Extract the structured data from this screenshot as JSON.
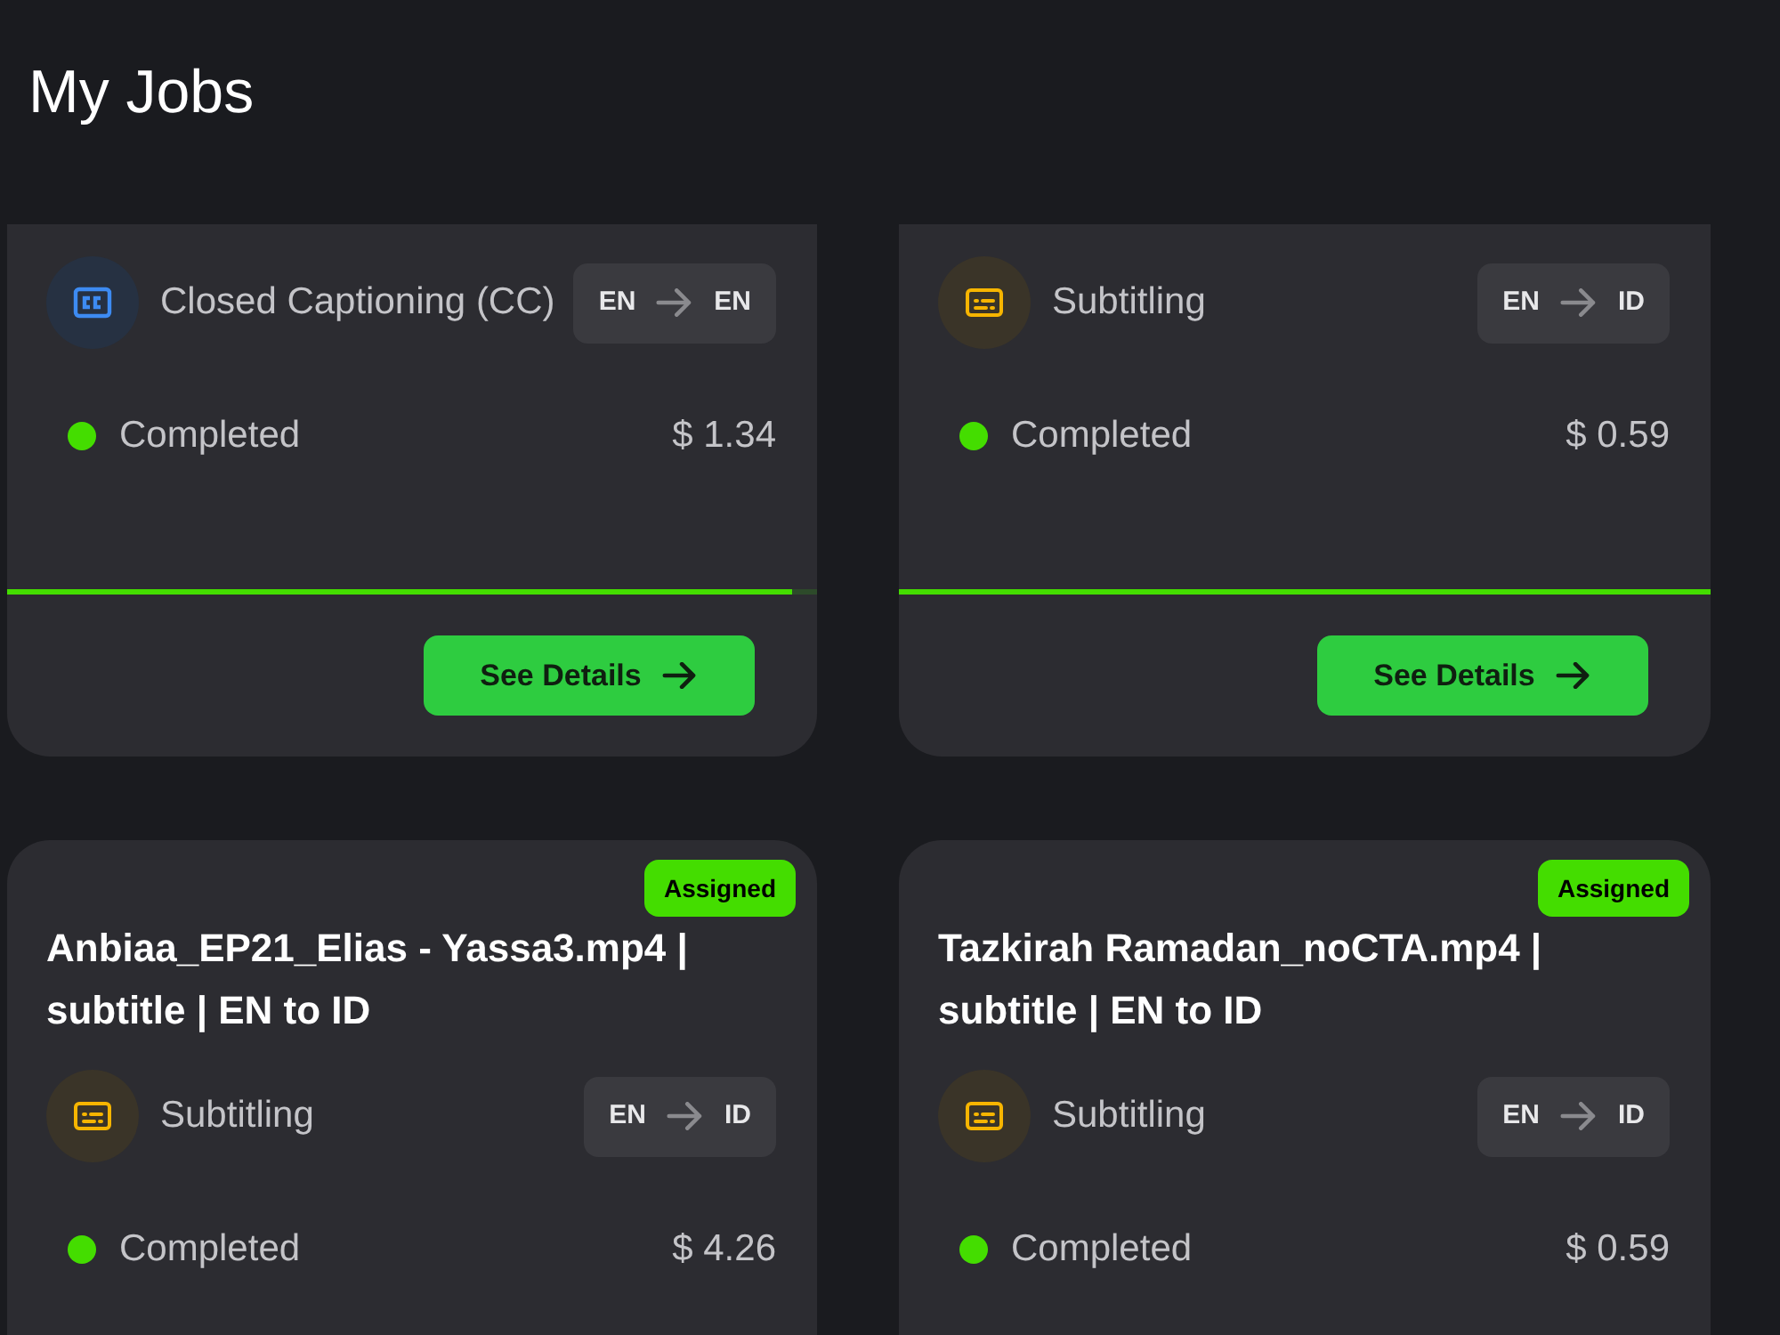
{
  "page": {
    "title": "My Jobs"
  },
  "jobs": [
    {
      "service": {
        "kind": "cc",
        "name": "Closed Captioning (CC)"
      },
      "languages": {
        "source": "EN",
        "target": "EN"
      },
      "status": {
        "label": "Completed",
        "color": "#44dd00"
      },
      "price": "$ 1.34",
      "progress": {
        "level": 0.97
      },
      "button": "See Details"
    },
    {
      "service": {
        "kind": "subtitle",
        "name": "Subtitling"
      },
      "languages": {
        "source": "EN",
        "target": "ID"
      },
      "status": {
        "label": "Completed",
        "color": "#44dd00"
      },
      "price": "$ 0.59",
      "progress": {
        "level": 1
      },
      "button": "See Details"
    },
    {
      "badge": "Assigned",
      "title": "Anbiaa_EP21_Elias - Yassa3.mp4 | subtitle | EN to ID",
      "service": {
        "kind": "subtitle",
        "name": "Subtitling"
      },
      "languages": {
        "source": "EN",
        "target": "ID"
      },
      "status": {
        "label": "Completed",
        "color": "#44dd00"
      },
      "price": "$ 4.26"
    },
    {
      "badge": "Assigned",
      "title": "Tazkirah Ramadan_noCTA.mp4 | subtitle | EN to ID",
      "service": {
        "kind": "subtitle",
        "name": "Subtitling"
      },
      "languages": {
        "source": "EN",
        "target": "ID"
      },
      "status": {
        "label": "Completed",
        "color": "#44dd00"
      },
      "price": "$ 0.59"
    }
  ]
}
